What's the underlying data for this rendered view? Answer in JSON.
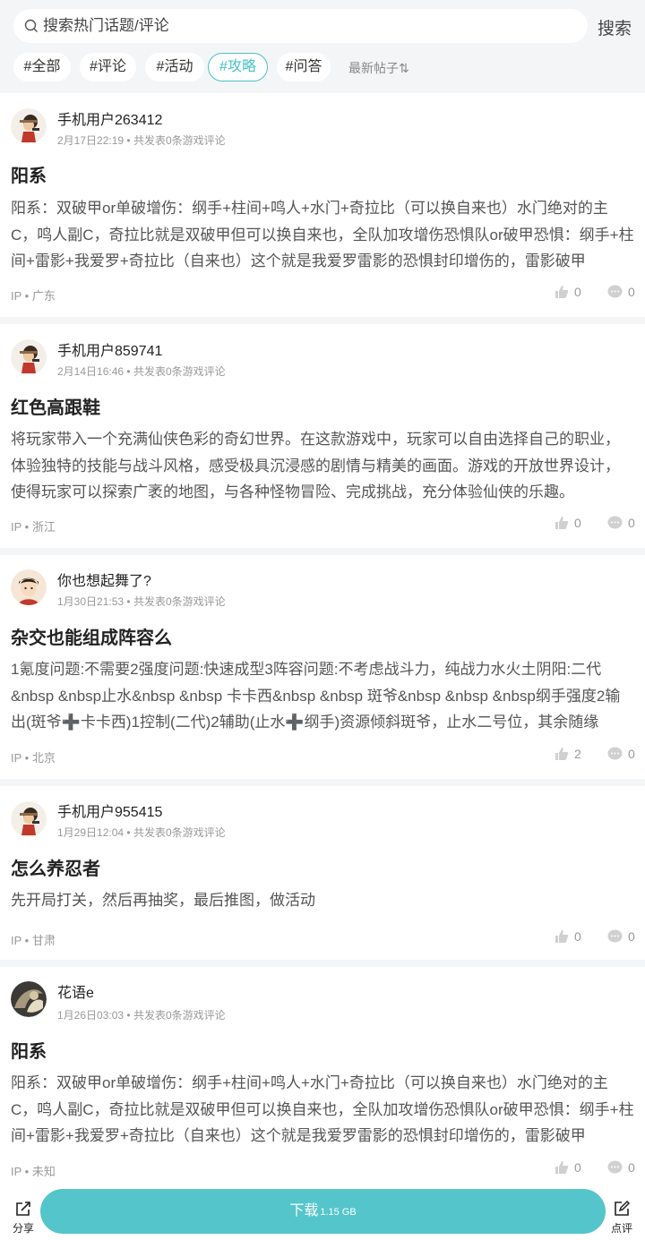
{
  "search": {
    "placeholder": "搜索热门话题/评论",
    "button": "搜索"
  },
  "tags": [
    "#全部",
    "#评论",
    "#活动",
    "#攻略",
    "#问答"
  ],
  "active_tag": "#攻略",
  "sort_label": "最新帖子⇅",
  "posts": [
    {
      "user": "手机用户263412",
      "time": "2月17日22:19",
      "stats": "共发表0条游戏评论",
      "title": "阳系",
      "body": "阳系：双破甲or单破增伤：纲手+柱间+鸣人+水门+奇拉比（可以换自来也）水门绝对的主C，鸣人副C，奇拉比就是双破甲但可以换自来也，全队加攻增伤恐惧队or破甲恐惧：纲手+柱间+雷影+我爱罗+奇拉比（自来也）这个就是我爱罗雷影的恐惧封印增伤的，雷影破甲",
      "ip": "IP • 广东",
      "likes": "0",
      "comments": "0",
      "avatar": "ninja"
    },
    {
      "user": "手机用户859741",
      "time": "2月14日16:46",
      "stats": "共发表0条游戏评论",
      "title": "红色高跟鞋",
      "body": "将玩家带入一个充满仙侠色彩的奇幻世界。在这款游戏中，玩家可以自由选择自己的职业，体验独特的技能与战斗风格，感受极具沉浸感的剧情与精美的画面。游戏的开放世界设计，使得玩家可以探索广袤的地图，与各种怪物冒险、完成挑战，充分体验仙侠的乐趣。",
      "ip": "IP • 浙江",
      "likes": "0",
      "comments": "0",
      "avatar": "ninja"
    },
    {
      "user": "你也想起舞了?",
      "time": "1月30日21:53",
      "stats": "共发表0条游戏评论",
      "title": "杂交也能组成阵容么",
      "body": "1氪度问题:不需要2强度问题:快速成型3阵容问题:不考虑战斗力，纯战力水火土阴阳:二代&nbsp &nbsp止水&nbsp &nbsp 卡卡西&nbsp &nbsp 斑爷&nbsp &nbsp &nbsp纲手强度2输出(斑爷➕卡卡西)1控制(二代)2辅助(止水➕纲手)资源倾斜斑爷，止水二号位，其余随缘",
      "ip": "IP • 北京",
      "likes": "2",
      "comments": "0",
      "avatar": "boy"
    },
    {
      "user": "手机用户955415",
      "time": "1月29日12:04",
      "stats": "共发表0条游戏评论",
      "title": "怎么养忍者",
      "body": "先开局打关，然后再抽奖，最后推图，做活动",
      "ip": "IP • 甘肃",
      "likes": "0",
      "comments": "0",
      "avatar": "ninja"
    },
    {
      "user": "花语e",
      "time": "1月26日03:03",
      "stats": "共发表0条游戏评论",
      "title": "阳系",
      "body": "阳系：双破甲or单破增伤：纲手+柱间+鸣人+水门+奇拉比（可以换自来也）水门绝对的主C，鸣人副C，奇拉比就是双破甲但可以换自来也，全队加攻增伤恐惧队or破甲恐惧：纲手+柱间+雷影+我爱罗+奇拉比（自来也）这个就是我爱罗雷影的恐惧封印增伤的，雷影破甲",
      "ip": "IP • 未知",
      "likes": "0",
      "comments": "0",
      "avatar": "dark"
    }
  ],
  "bottom": {
    "share": "分享",
    "download": "下载",
    "size": "1.15 GB",
    "review": "点评"
  },
  "colors": {
    "accent": "#49c1c6",
    "download_bg": "#54c5cb"
  }
}
